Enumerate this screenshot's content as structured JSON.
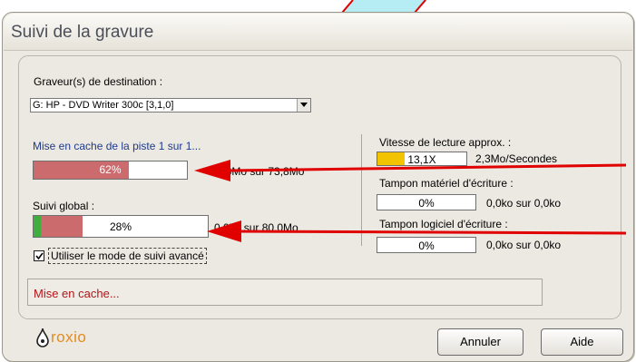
{
  "window": {
    "title": "Suivi de la gravure"
  },
  "destination": {
    "label": "Graveur(s) de destination :",
    "selected": "G: HP - DVD Writer 300c [3,1,0]"
  },
  "track_cache": {
    "label": "Mise en cache de la piste 1 sur 1...",
    "progress_text": "62%",
    "progress_value": 0.62,
    "size_text": "45,8Mo sur 73,8Mo",
    "fill_color": "#cc6b6e"
  },
  "global": {
    "label": "Suivi global :",
    "progress_text": "28%",
    "progress_value": 0.28,
    "size_text": "0,0ko sur 80,0Mo",
    "fill_color": "#cc6b6e",
    "start_color": "#3fae3f"
  },
  "read_speed": {
    "label": "Vitesse de lecture approx. :",
    "bar_text": "13,1X",
    "value_text": "2,3Mo/Secondes",
    "fill_color": "#f2c300"
  },
  "hw_buffer": {
    "label": "Tampon matériel d'écriture :",
    "bar_text": "0%",
    "value_text": "0,0ko sur 0,0ko"
  },
  "sw_buffer": {
    "label": "Tampon logiciel d'écriture :",
    "bar_text": "0%",
    "value_text": "0,0ko sur 0,0ko"
  },
  "advanced_mode": {
    "label": "Utiliser le mode de suivi avancé",
    "checked": true
  },
  "status": {
    "text": "Mise en cache..."
  },
  "logo": {
    "text": "roxio",
    "color": "#e78a1c"
  },
  "buttons": {
    "cancel": "Annuler",
    "help": "Aide"
  },
  "annotations": {
    "arrow_color": "#e00000"
  }
}
